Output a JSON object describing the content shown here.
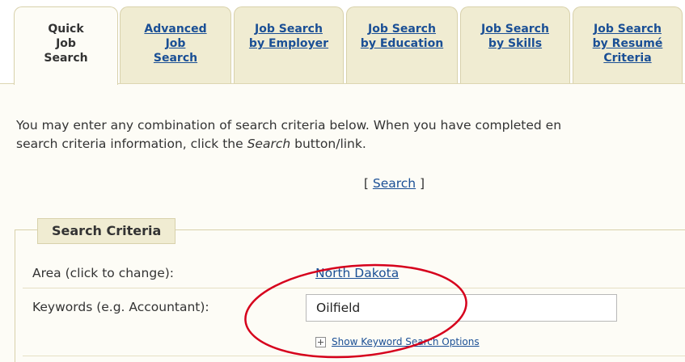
{
  "tabs": [
    {
      "lines": [
        "Quick",
        "Job",
        "Search"
      ],
      "active": true
    },
    {
      "lines": [
        "Advanced",
        "Job",
        "Search"
      ],
      "active": false
    },
    {
      "lines": [
        "Job Search",
        "by Employer"
      ],
      "active": false
    },
    {
      "lines": [
        "Job Search",
        "by Education"
      ],
      "active": false
    },
    {
      "lines": [
        "Job Search",
        "by Skills"
      ],
      "active": false
    },
    {
      "lines": [
        "Job Search",
        "by Resumé",
        "Criteria"
      ],
      "active": false
    }
  ],
  "intro": {
    "line1": "You may enter any combination of search criteria below. When you have completed en",
    "line2_before": "search criteria information, click the ",
    "line2_emph": "Search",
    "line2_after": " button/link."
  },
  "search_link": {
    "open": "[ ",
    "label": "Search",
    "close": " ]"
  },
  "search_criteria": {
    "legend": "Search Criteria",
    "area_label": "Area (click to change):",
    "area_value": "North Dakota",
    "keywords_label": "Keywords (e.g. Accountant):",
    "keywords_value": "Oilfield",
    "keyword_options_label": "Show Keyword Search Options"
  },
  "colors": {
    "tab_background": "#f0ecd2",
    "link": "#1a4f95",
    "annotation_circle": "#d6001c"
  },
  "icons": {
    "keyword_options": "plus-box-icon"
  }
}
